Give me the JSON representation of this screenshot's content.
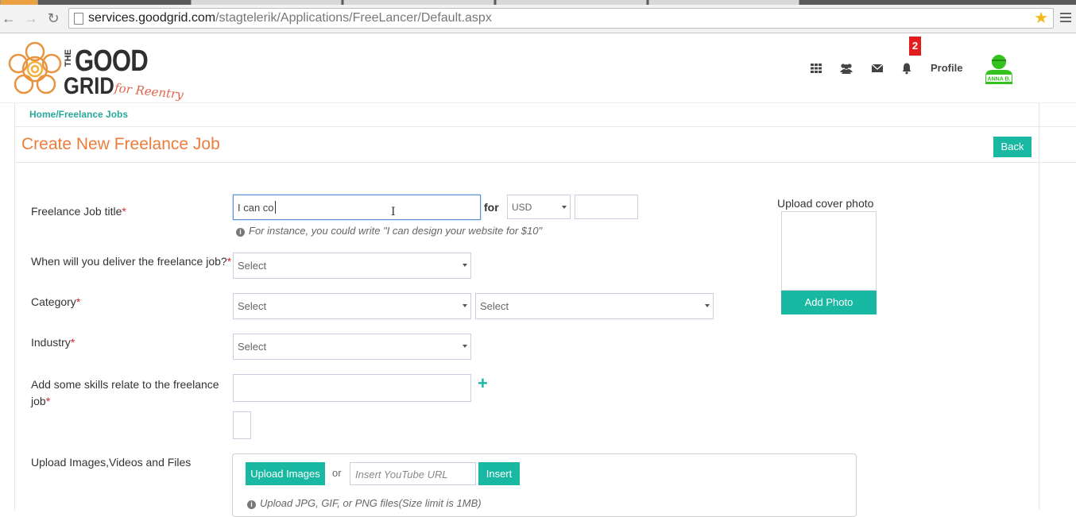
{
  "browser": {
    "url_host": "services.goodgrid.com",
    "url_path": "/stagtelerik/Applications/FreeLancer/Default.aspx"
  },
  "header": {
    "logo": {
      "the": "THE",
      "good": "GOOD",
      "grid": "GRID",
      "tagline": "for Reentry"
    },
    "notification_count": "2",
    "profile_label": "Profile",
    "avatar_name": "ANNA B."
  },
  "breadcrumb": "Home/Freelance Jobs",
  "page": {
    "title": "Create New Freelance Job",
    "back_label": "Back"
  },
  "form": {
    "title_label": "Freelance Job title",
    "title_value": "I can co",
    "for_label": "for",
    "currency_value": "USD",
    "price_value": "",
    "title_hint": "For instance, you could write \"I can design your website for $10\"",
    "deliver_label": "When will you deliver the freelance job?",
    "deliver_value": "Select",
    "category_label": "Category",
    "category_value": "Select",
    "subcategory_value": "Select",
    "industry_label": "Industry",
    "industry_value": "Select",
    "skills_label_line1": "Add some skills relate to the freelance",
    "skills_label_line2": "job",
    "skills_value": "",
    "required_marker": "*",
    "upload_label": "Upload Images,Videos and Files",
    "upload_images_label": "Upload Images",
    "or_label": "or",
    "youtube_placeholder": "Insert YouTube URL",
    "insert_label": "Insert",
    "upload_hint": "Upload JPG, GIF, or PNG files(Size limit is 1MB)"
  },
  "cover": {
    "label": "Upload cover photo",
    "add_photo_label": "Add Photo"
  },
  "colors": {
    "accent_teal": "#19b8a2",
    "title_orange": "#ec7c3a",
    "required_red": "#d9232a",
    "badge_red": "#e21c1c"
  }
}
